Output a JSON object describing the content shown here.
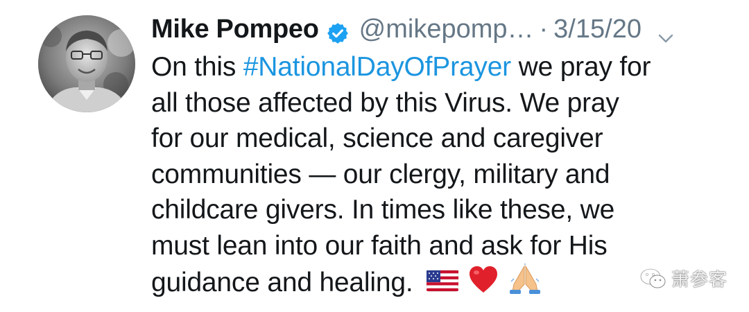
{
  "tweet": {
    "author": {
      "display_name": "Mike Pompeo",
      "handle": "@mikepomp…",
      "verified": true
    },
    "separator": "·",
    "date": "3/15/20",
    "menu_icon": "chevron-down-icon",
    "text": {
      "line1_prefix": "On this ",
      "hashtag": "#NationalDayOfPrayer",
      "line1_suffix": " we pray for",
      "line2": "all those affected by this Virus. We pray",
      "line3": "for our medical, science and caregiver",
      "line4": "communities — our clergy, military and",
      "line5": "childcare givers. In times like these, we",
      "line6": "must lean into our faith and ask for His",
      "line7": "guidance and healing."
    },
    "emojis": [
      "us-flag-emoji",
      "red-heart-emoji",
      "folded-hands-emoji"
    ]
  },
  "watermark": {
    "icon": "wechat-icon",
    "label": "萧参客"
  },
  "colors": {
    "text": "#14171a",
    "secondary": "#657786",
    "link": "#1b95e0",
    "verified": "#1da1f2"
  }
}
